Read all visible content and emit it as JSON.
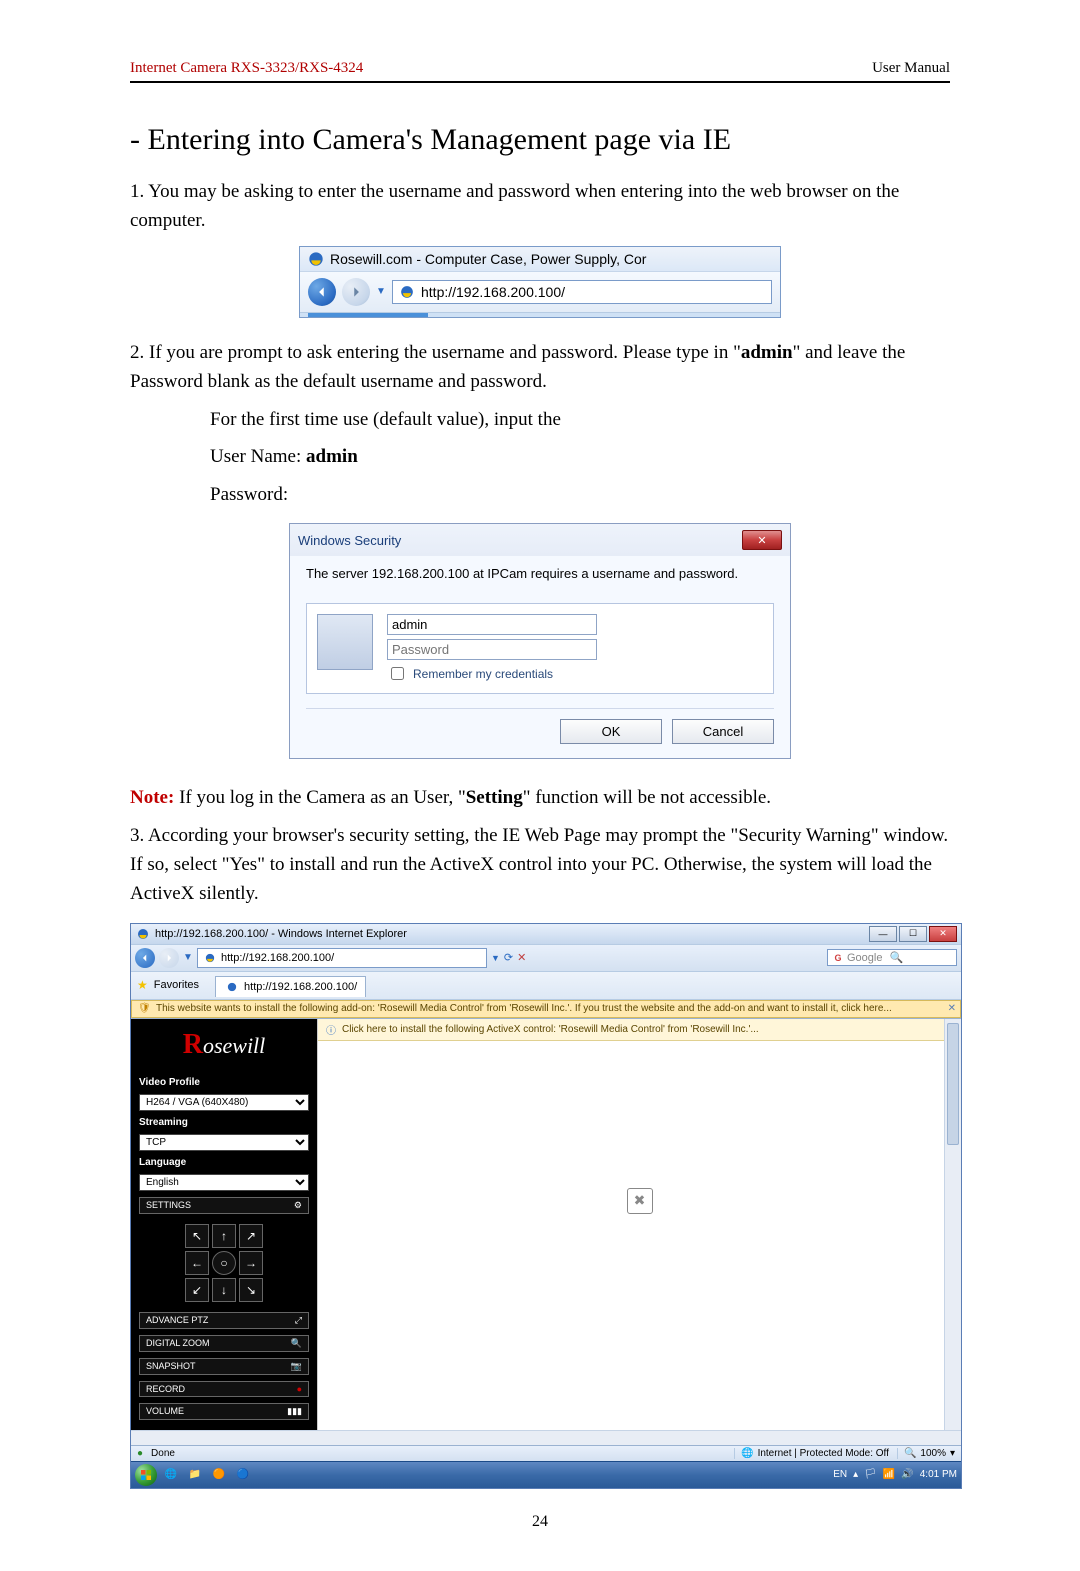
{
  "header": {
    "left": "Internet Camera RXS-3323/RXS-4324",
    "right": "User Manual"
  },
  "section_title": "- Entering into Camera's Management page via IE",
  "para1": "1. You may be asking to enter the username and password when entering into the web browser on the computer.",
  "ie_top": {
    "title_text": "Rosewill.com - Computer Case, Power Supply, Cor",
    "url": "http://192.168.200.100/"
  },
  "para2_a": "2. If you are prompt to ask entering the username and password. Please type in \"",
  "para2_admin": "admin",
  "para2_b": "\" and leave the Password blank as the default username and password.",
  "indent_line1": "For the first time use (default value), input the",
  "indent_line2a": "User Name: ",
  "indent_line2b": "admin",
  "indent_line3": "Password:",
  "winsec": {
    "title": "Windows Security",
    "msg": "The server 192.168.200.100 at IPCam requires a username and password.",
    "username_value": "admin",
    "password_placeholder": "Password",
    "remember_label": "Remember my credentials",
    "ok": "OK",
    "cancel": "Cancel"
  },
  "note_label": "Note:",
  "note_body_a": " If you log in the Camera as an User, \"",
  "note_setting": "Setting",
  "note_body_b": "\" function will be not accessible.",
  "para3": "3. According your browser's security setting, the IE Web Page may prompt the \"Security Warning\" window. If so, select \"Yes\" to install and run the ActiveX control into your PC. Otherwise, the system will load the ActiveX silently.",
  "ie_window": {
    "title": "http://192.168.200.100/ - Windows Internet Explorer",
    "address": "http://192.168.200.100/",
    "search_placeholder": "Google",
    "favorites_label": "Favorites",
    "tab_label": "http://192.168.200.100/",
    "info_bar": "This website wants to install the following add-on: 'Rosewill Media Control' from 'Rosewill Inc.'. If you trust the website and the add-on and want to install it, click here...",
    "activex_bar": "Click here to install the following ActiveX control: 'Rosewill Media Control' from 'Rosewill Inc.'...",
    "sidebar": {
      "logo_r": "R",
      "logo_rest": "osewill",
      "video_profile_label": "Video Profile",
      "video_profile_value": "H264 / VGA (640X480)",
      "streaming_label": "Streaming",
      "streaming_value": "TCP",
      "language_label": "Language",
      "language_value": "English",
      "settings": "SETTINGS",
      "advance_ptz": "ADVANCE PTZ",
      "digital_zoom": "DIGITAL ZOOM",
      "snapshot": "SNAPSHOT",
      "record": "RECORD",
      "volume": "VOLUME"
    },
    "status": {
      "done": "Done",
      "zone": "Internet | Protected Mode: Off",
      "zoom": "100%"
    },
    "taskbar": {
      "lang": "EN",
      "time": "4:01 PM"
    }
  },
  "page_number": "24"
}
